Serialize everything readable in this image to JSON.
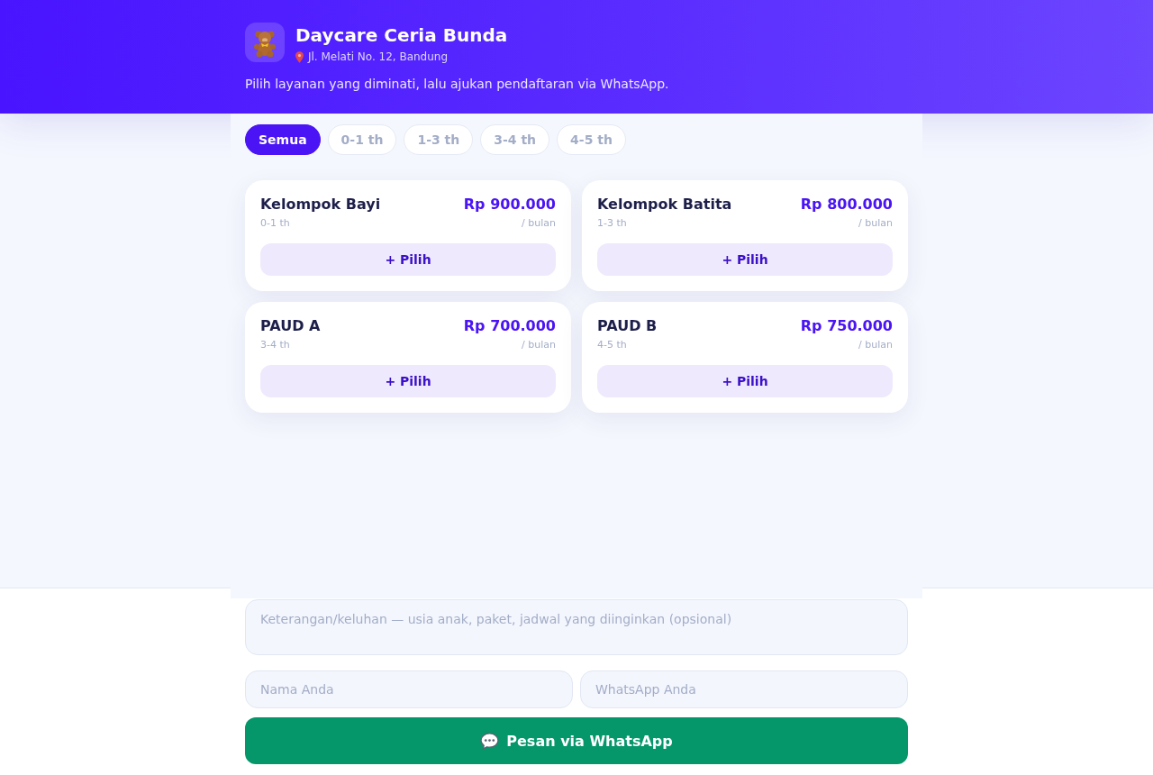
{
  "header": {
    "title": "Daycare Ceria Bunda",
    "address": "Jl. Melati No. 12, Bandung",
    "description": "Pilih layanan yang diminati, lalu ajukan pendaftaran via WhatsApp."
  },
  "filters": [
    {
      "label": "Semua",
      "selected": true
    },
    {
      "label": "0-1 th",
      "selected": false
    },
    {
      "label": "1-3 th",
      "selected": false
    },
    {
      "label": "3-4 th",
      "selected": false
    },
    {
      "label": "4-5 th",
      "selected": false
    }
  ],
  "services": [
    {
      "name": "Kelompok Bayi",
      "age": "0-1 th",
      "price": "Rp 900.000",
      "period": "/ bulan",
      "button": "+ Pilih"
    },
    {
      "name": "Kelompok Batita",
      "age": "1-3 th",
      "price": "Rp 800.000",
      "period": "/ bulan",
      "button": "+ Pilih"
    },
    {
      "name": "PAUD A",
      "age": "3-4 th",
      "price": "Rp 700.000",
      "period": "/ bulan",
      "button": "+ Pilih"
    },
    {
      "name": "PAUD B",
      "age": "4-5 th",
      "price": "Rp 750.000",
      "period": "/ bulan",
      "button": "+ Pilih"
    }
  ],
  "form": {
    "notes": {
      "placeholder": "Keterangan/keluhan — usia anak, paket, jadwal yang diinginkan (opsional)"
    },
    "name": {
      "placeholder": "Nama Anda"
    },
    "whatsapp": {
      "placeholder": "WhatsApp Anda"
    },
    "submit": "Pesan via WhatsApp"
  }
}
